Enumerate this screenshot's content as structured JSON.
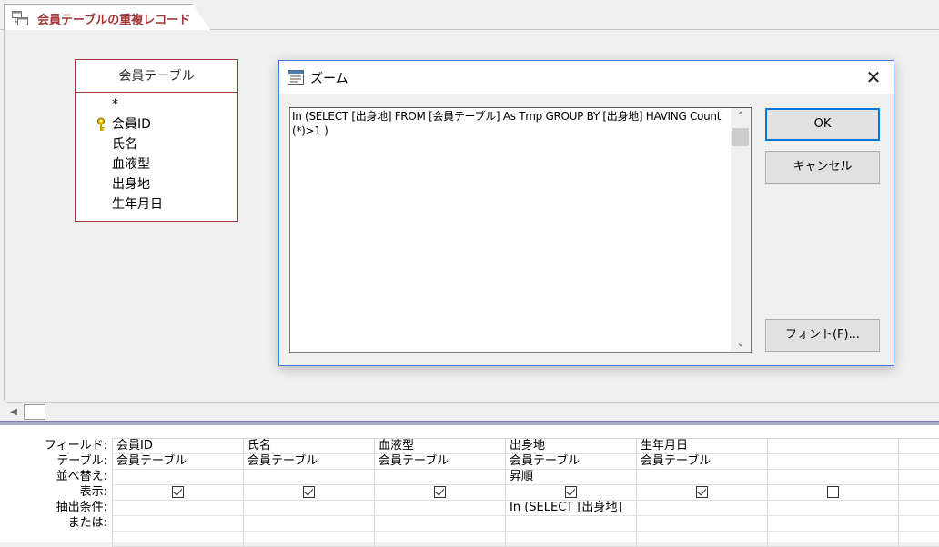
{
  "document": {
    "tab_title": "会員テーブルの重複レコード"
  },
  "field_list": {
    "title": "会員テーブル",
    "fields": [
      "*",
      "会員ID",
      "氏名",
      "血液型",
      "出身地",
      "生年月日"
    ]
  },
  "zoom_dialog": {
    "title": "ズーム",
    "close_glyph": "✕",
    "text": "In (SELECT [出身地] FROM [会員テーブル] As Tmp GROUP BY [出身地] HAVING Count(*)>1  )",
    "ok_label": "OK",
    "cancel_label": "キャンセル",
    "font_label": "フォント(F)..."
  },
  "qbe_grid": {
    "row_labels": [
      "フィールド:",
      "テーブル:",
      "並べ替え:",
      "表示:",
      "抽出条件:",
      "または:"
    ],
    "columns": [
      {
        "field": "会員ID",
        "table": "会員テーブル",
        "sort": "",
        "show": true,
        "criteria": ""
      },
      {
        "field": "氏名",
        "table": "会員テーブル",
        "sort": "",
        "show": true,
        "criteria": ""
      },
      {
        "field": "血液型",
        "table": "会員テーブル",
        "sort": "",
        "show": true,
        "criteria": ""
      },
      {
        "field": "出身地",
        "table": "会員テーブル",
        "sort": "昇順",
        "show": true,
        "criteria": "In (SELECT [出身地]"
      },
      {
        "field": "生年月日",
        "table": "会員テーブル",
        "sort": "",
        "show": true,
        "criteria": ""
      },
      {
        "field": "",
        "table": "",
        "sort": "",
        "show": false,
        "criteria": ""
      },
      {
        "field": "",
        "table": "",
        "sort": "",
        "show": false,
        "criteria": ""
      }
    ]
  },
  "icons": {
    "tab_icon": "query-design-icon",
    "key_icon": "primary-key-icon",
    "zoom_icon": "zoom-window-icon"
  },
  "colors": {
    "accent": "#a4373a",
    "dialog_border": "#3a7bd5",
    "default_button": "#0078d7"
  }
}
